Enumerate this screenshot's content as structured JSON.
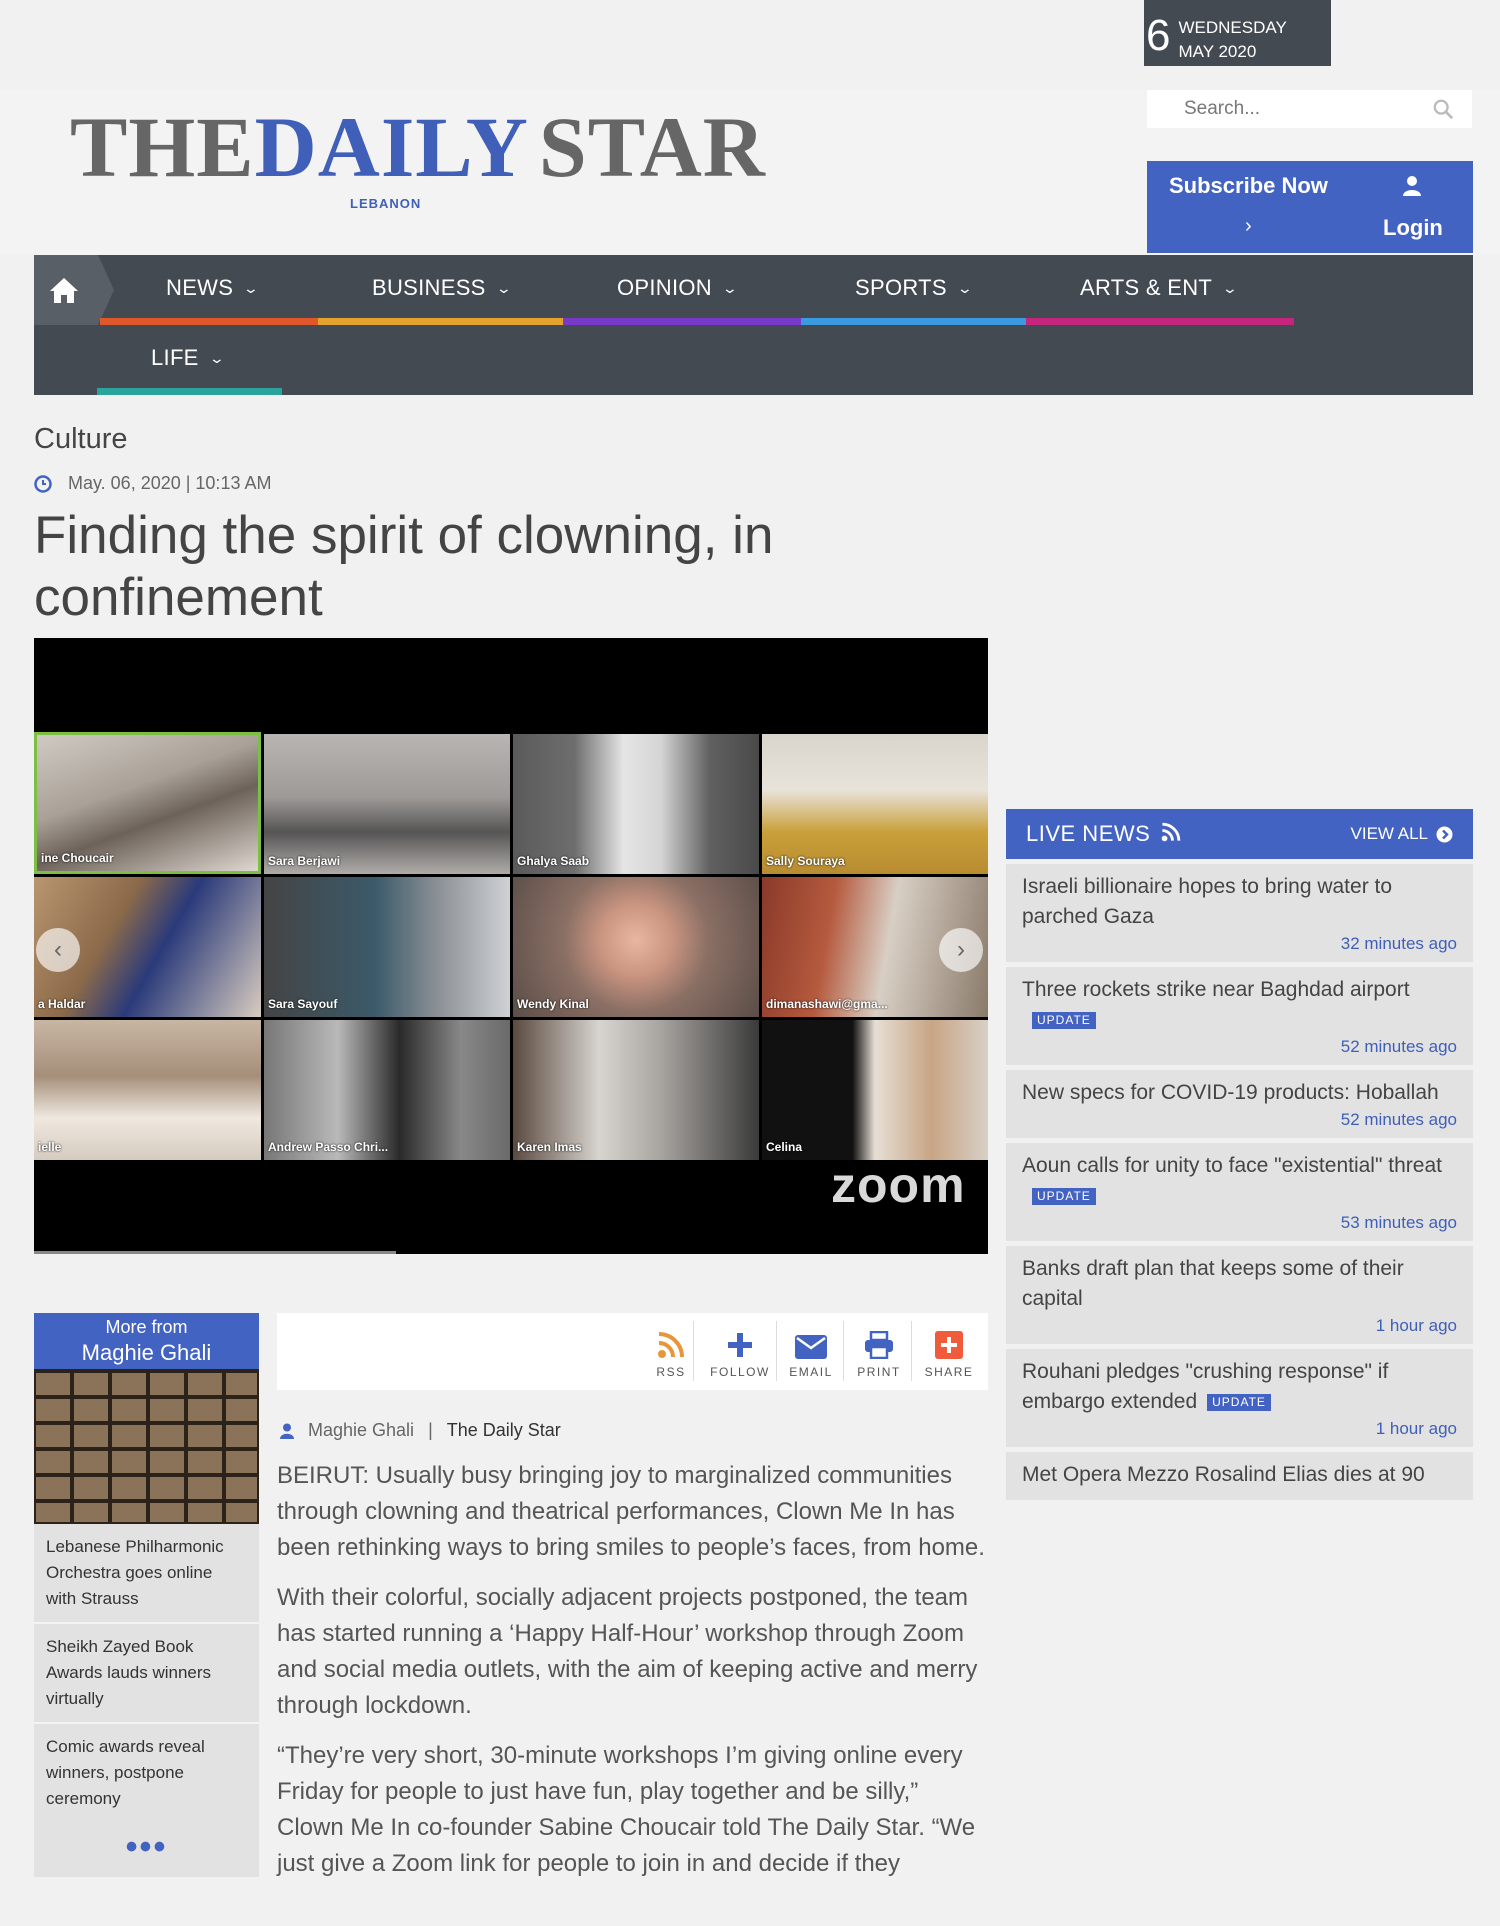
{
  "date": {
    "day": "6",
    "weekday": "WEDNESDAY",
    "month_year": "MAY 2020"
  },
  "logo": {
    "the": "THE",
    "daily": "DAILY",
    "star": "STAR",
    "sub": "LEBANON"
  },
  "search": {
    "placeholder": "Search..."
  },
  "subscribe": {
    "label": "Subscribe Now",
    "chevron": "›",
    "login": "Login"
  },
  "nav": {
    "items": [
      {
        "label": "NEWS",
        "color": "#e0572a"
      },
      {
        "label": "BUSINESS",
        "color": "#e3a32e"
      },
      {
        "label": "OPINION",
        "color": "#7a3ac9"
      },
      {
        "label": "SPORTS",
        "color": "#3a9be0"
      },
      {
        "label": "ARTS & ENT",
        "color": "#c4267d"
      },
      {
        "label": "LIFE",
        "color": "#2aa39c"
      }
    ]
  },
  "article": {
    "kicker": "Culture",
    "timestamp": "May. 06, 2020 | 10:13 AM",
    "title": "Finding the spirit of clowning, in confinement",
    "author": "Maghie Ghali",
    "source": "The Daily Star",
    "paragraphs": [
      "BEIRUT: Usually busy bringing joy to marginalized communities through clowning and theatrical performances, Clown Me In has been rethinking ways to bring smiles to people’s faces, from home.",
      "With their colorful, socially adjacent projects postponed, the team has started running a ‘Happy Half-Hour’ workshop through Zoom and social media outlets, with the aim of keeping active and merry through lockdown.",
      "“They’re very short, 30-minute workshops I’m giving online every Friday for people to just have fun, play together and be silly,” Clown Me In co-founder Sabine Choucair told The Daily Star. “We just give a Zoom link for people to join in and decide if they"
    ]
  },
  "photo": {
    "watermark": "zoom",
    "participants": [
      "ine Choucair",
      "Sara Berjawi",
      "Ghalya Saab",
      "Sally Souraya",
      "a Haldar",
      "Sara Sayouf",
      "Wendy Kinal",
      "dimanashawi@gma...",
      "ielle",
      "Andrew Passo Chri...",
      "Karen Imas",
      "Celina"
    ]
  },
  "more_from": {
    "line1": "More from",
    "author": "Maghie Ghali",
    "items": [
      "Lebanese Philharmonic Orchestra goes online with Strauss",
      "Sheikh Zayed Book Awards lauds winners virtually",
      "Comic awards reveal winners, postpone ceremony"
    ],
    "more": "•••"
  },
  "toolbar": {
    "items": [
      {
        "label": "RSS",
        "icon": "rss-icon",
        "color": "#e8963a"
      },
      {
        "label": "FOLLOW",
        "icon": "plus-icon",
        "color": "#4363c3"
      },
      {
        "label": "EMAIL",
        "icon": "envelope-icon",
        "color": "#4363c3"
      },
      {
        "label": "PRINT",
        "icon": "printer-icon",
        "color": "#4363c3"
      },
      {
        "label": "SHARE",
        "icon": "share-plus-icon",
        "color": "#ef5b3b"
      }
    ]
  },
  "live_news": {
    "title": "LIVE NEWS",
    "view_all": "VIEW ALL",
    "update_label": "UPDATE",
    "items": [
      {
        "headline": "Israeli billionaire hopes to bring water to parched Gaza",
        "time": "32 minutes ago",
        "update": false
      },
      {
        "headline": "Three rockets strike near Baghdad airport",
        "time": "52 minutes ago",
        "update": true
      },
      {
        "headline": "New specs for COVID-19 products: Hoballah",
        "time": "52 minutes ago",
        "update": false
      },
      {
        "headline": "Aoun calls for unity to face \"existential\" threat",
        "time": "53 minutes ago",
        "update": true
      },
      {
        "headline": "Banks draft plan that keeps some of their capital",
        "time": "1 hour ago",
        "update": false
      },
      {
        "headline": "Rouhani pledges \"crushing response\" if embargo extended",
        "time": "1 hour ago",
        "update": true
      },
      {
        "headline": "Met Opera Mezzo Rosalind Elias dies at 90",
        "time": "",
        "update": false
      }
    ]
  },
  "colors": {
    "brand_blue": "#4363c3",
    "nav_bg": "#444a52"
  }
}
